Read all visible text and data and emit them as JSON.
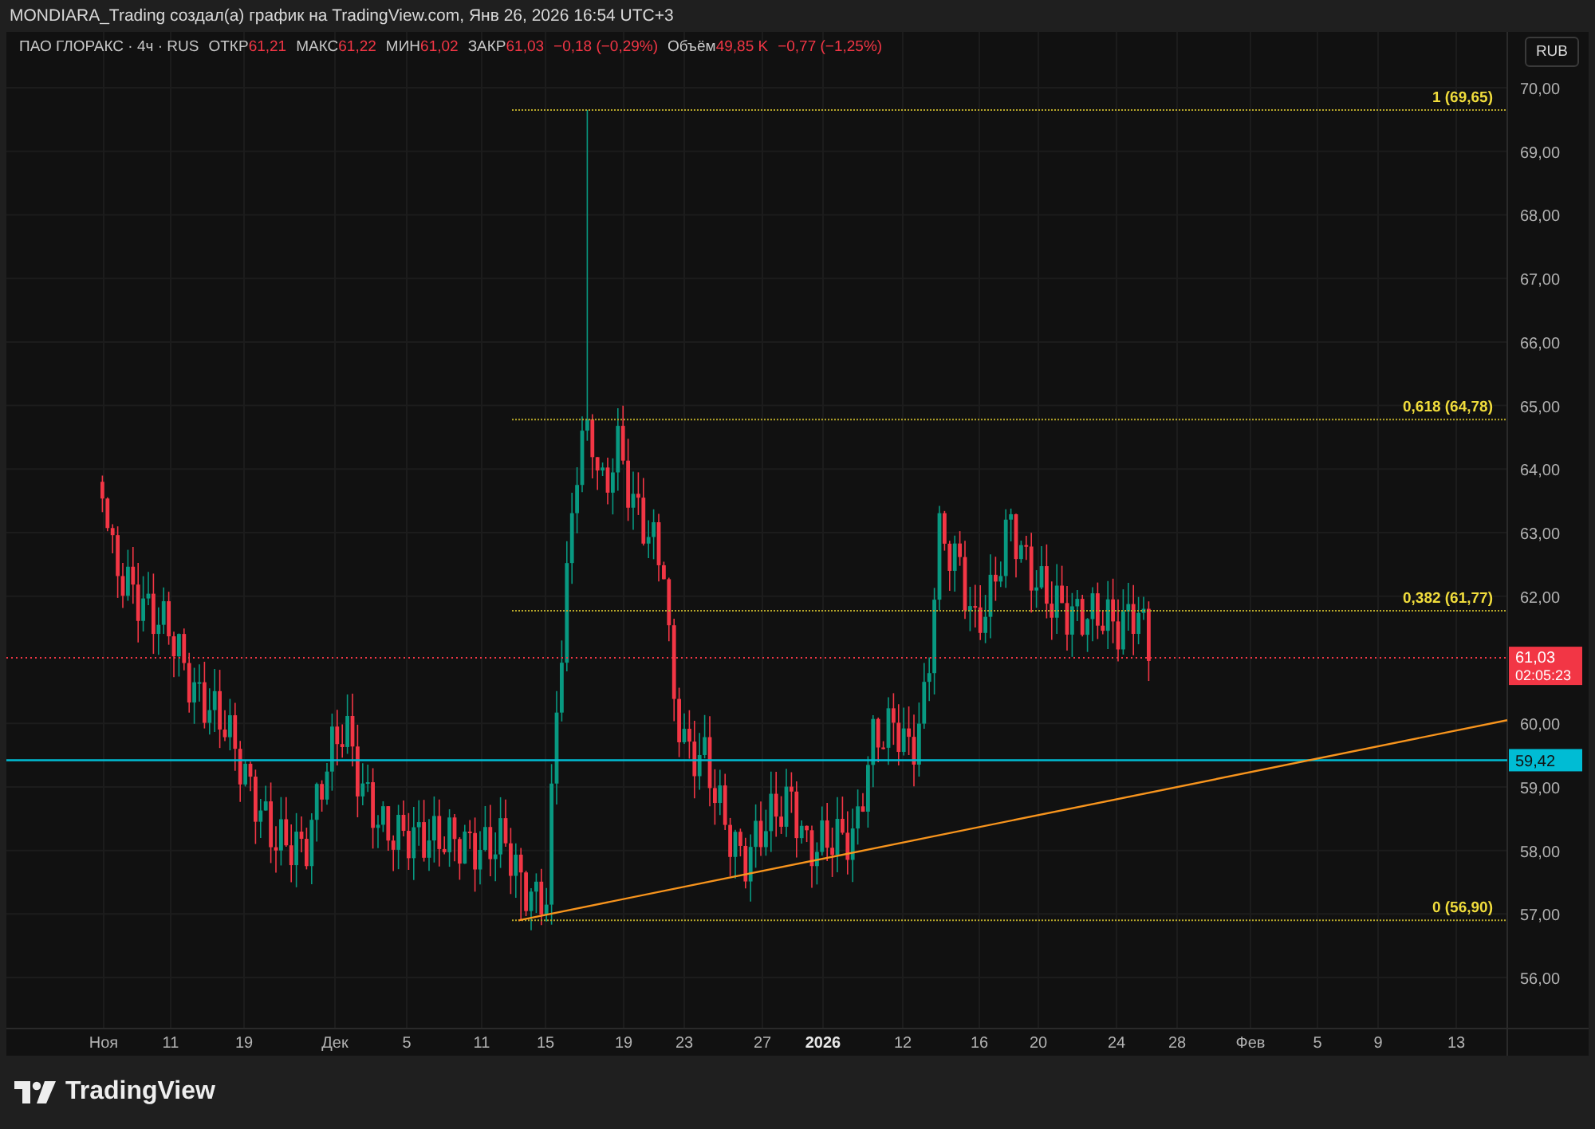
{
  "header": {
    "title": "MONDIARA_Trading создал(а) график на TradingView.com, Янв 26, 2026 16:54 UTC+3"
  },
  "legend": {
    "symbol": "ПАО ГЛОРАКС · 4ч · RUS",
    "fields": [
      {
        "label": "ОТКР",
        "value": "61,21"
      },
      {
        "label": "МАКС",
        "value": "61,22"
      },
      {
        "label": "МИН",
        "value": "61,02"
      },
      {
        "label": "ЗАКР",
        "value": "61,03"
      }
    ],
    "change": "−0,18 (−0,29%)",
    "volume_label": "Объём",
    "volume": "49,85 K",
    "volume_change": "−0,77 (−1,25%)"
  },
  "currency_button": "RUB",
  "price_axis": {
    "ticks": [
      "70,00",
      "69,00",
      "68,00",
      "67,00",
      "66,00",
      "65,00",
      "64,00",
      "63,00",
      "62,00",
      "60,00",
      "59,00",
      "58,00",
      "57,00",
      "56,00"
    ]
  },
  "time_axis": {
    "ticks": [
      {
        "label": "Ноя",
        "emphasized": false
      },
      {
        "label": "11",
        "emphasized": false
      },
      {
        "label": "19",
        "emphasized": false
      },
      {
        "label": "Дек",
        "emphasized": false
      },
      {
        "label": "5",
        "emphasized": false
      },
      {
        "label": "11",
        "emphasized": false
      },
      {
        "label": "15",
        "emphasized": false
      },
      {
        "label": "19",
        "emphasized": false
      },
      {
        "label": "23",
        "emphasized": false
      },
      {
        "label": "27",
        "emphasized": false
      },
      {
        "label": "2026",
        "emphasized": true
      },
      {
        "label": "12",
        "emphasized": false
      },
      {
        "label": "16",
        "emphasized": false
      },
      {
        "label": "20",
        "emphasized": false
      },
      {
        "label": "24",
        "emphasized": false
      },
      {
        "label": "28",
        "emphasized": false
      },
      {
        "label": "Фев",
        "emphasized": false
      },
      {
        "label": "5",
        "emphasized": false
      },
      {
        "label": "9",
        "emphasized": false
      },
      {
        "label": "13",
        "emphasized": false
      }
    ]
  },
  "fib_levels": [
    {
      "label": "1 (69,65)"
    },
    {
      "label": "0,618 (64,78)"
    },
    {
      "label": "0,382 (61,77)"
    },
    {
      "label": "0 (56,90)"
    }
  ],
  "last_price": {
    "price": "61,03",
    "countdown": "02:05:23"
  },
  "horizontal_line": {
    "price": "59,42"
  },
  "footer": {
    "brand": "TradingView"
  }
}
